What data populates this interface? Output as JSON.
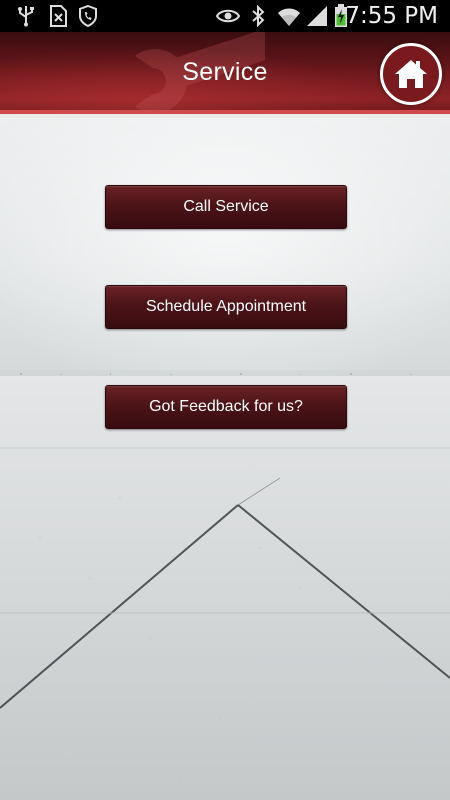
{
  "status_bar": {
    "time": "7:55 PM",
    "icons": [
      "usb-icon",
      "sim-card-icon",
      "phone-shield-icon",
      "eye-icon",
      "bluetooth-icon",
      "wifi-icon",
      "signal-icon",
      "battery-charging-icon"
    ]
  },
  "header": {
    "title": "Service",
    "home_icon": "home-icon",
    "watermark_icon": "wrench-icon",
    "colors": {
      "header_dark": "#3a0d10",
      "header_red": "#8d2226",
      "accent_line": "#d04b4b"
    }
  },
  "actions": [
    {
      "label": "Call Service"
    },
    {
      "label": "Schedule Appointment"
    },
    {
      "label": "Got Feedback for us?"
    }
  ],
  "colors": {
    "button_top": "#6a2226",
    "button_bottom": "#370c0f",
    "button_text": "#ffffff"
  }
}
